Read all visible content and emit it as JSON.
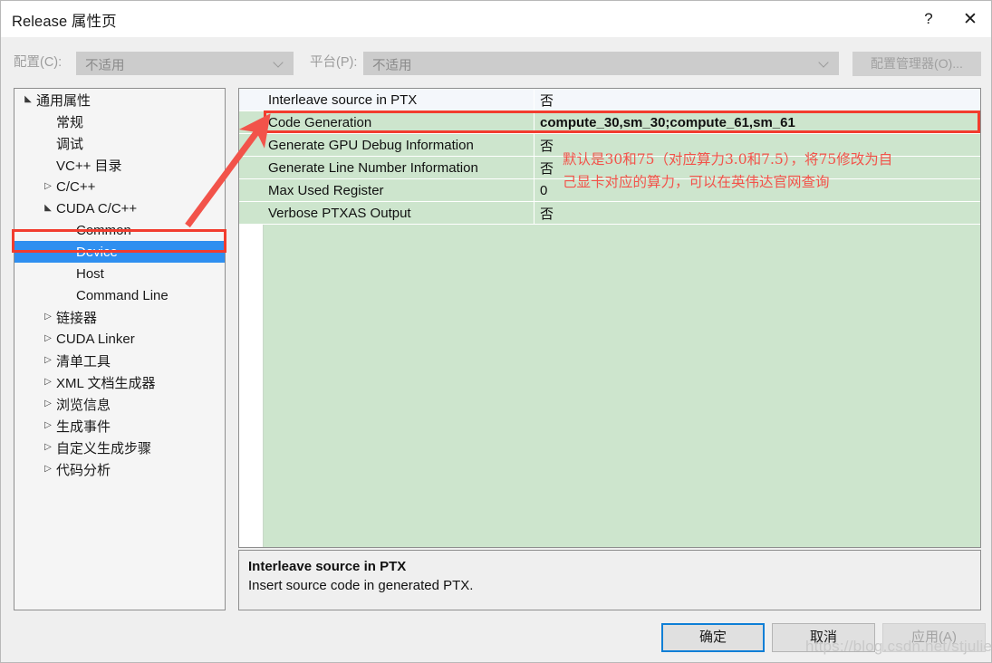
{
  "window": {
    "title": "Release 属性页",
    "help_icon_label": "?",
    "close_icon_label": "✕"
  },
  "config_bar": {
    "configuration_label": "配置(C):",
    "configuration_value": "不适用",
    "platform_label": "平台(P):",
    "platform_value": "不适用",
    "config_manager_button": "配置管理器(O)..."
  },
  "tree": {
    "items": [
      {
        "label": "通用属性",
        "indent": 0,
        "arrow": "▲",
        "selected": false
      },
      {
        "label": "常规",
        "indent": 1,
        "arrow": "",
        "selected": false
      },
      {
        "label": "调试",
        "indent": 1,
        "arrow": "",
        "selected": false
      },
      {
        "label": "VC++ 目录",
        "indent": 1,
        "arrow": "",
        "selected": false
      },
      {
        "label": "C/C++",
        "indent": 1,
        "arrow": "▷",
        "selected": false
      },
      {
        "label": "CUDA C/C++",
        "indent": 1,
        "arrow": "▲",
        "selected": false
      },
      {
        "label": "Common",
        "indent": 2,
        "arrow": "",
        "selected": false
      },
      {
        "label": "Device",
        "indent": 2,
        "arrow": "",
        "selected": true
      },
      {
        "label": "Host",
        "indent": 2,
        "arrow": "",
        "selected": false
      },
      {
        "label": "Command Line",
        "indent": 2,
        "arrow": "",
        "selected": false
      },
      {
        "label": "链接器",
        "indent": 1,
        "arrow": "▷",
        "selected": false
      },
      {
        "label": "CUDA Linker",
        "indent": 1,
        "arrow": "▷",
        "selected": false
      },
      {
        "label": "清单工具",
        "indent": 1,
        "arrow": "▷",
        "selected": false
      },
      {
        "label": "XML 文档生成器",
        "indent": 1,
        "arrow": "▷",
        "selected": false
      },
      {
        "label": "浏览信息",
        "indent": 1,
        "arrow": "▷",
        "selected": false
      },
      {
        "label": "生成事件",
        "indent": 1,
        "arrow": "▷",
        "selected": false
      },
      {
        "label": "自定义生成步骤",
        "indent": 1,
        "arrow": "▷",
        "selected": false
      },
      {
        "label": "代码分析",
        "indent": 1,
        "arrow": "▷",
        "selected": false
      }
    ]
  },
  "property_grid": {
    "rows": [
      {
        "name": "Interleave source in PTX",
        "value": "否",
        "first": true,
        "bold": false
      },
      {
        "name": "Code Generation",
        "value": "compute_30,sm_30;compute_61,sm_61",
        "first": false,
        "bold": true
      },
      {
        "name": "Generate GPU Debug Information",
        "value": "否",
        "first": false,
        "bold": false
      },
      {
        "name": "Generate Line Number Information",
        "value": "否",
        "first": false,
        "bold": false
      },
      {
        "name": "Max Used Register",
        "value": "0",
        "first": false,
        "bold": false
      },
      {
        "name": "Verbose PTXAS Output",
        "value": "否",
        "first": false,
        "bold": false
      }
    ],
    "highlighted_row_name": "Code Generation"
  },
  "annotation": {
    "line1": "默认是30和75（对应算力3.0和7.5），将75修改为自",
    "line2": "己显卡对应的算力，可以在英伟达官网查询",
    "color": "#f2534a"
  },
  "description": {
    "title": "Interleave source in PTX",
    "body": "Insert source code in generated PTX."
  },
  "footer": {
    "ok_label": "确定",
    "cancel_label": "取消",
    "apply_label": "应用(A)"
  },
  "watermark": {
    "text": "https://blog.csdn.net/stjuliet"
  },
  "colors": {
    "selection_blue": "#2f8ff0",
    "highlight_red": "#f23c2e",
    "grid_green": "#cde5cd",
    "ok_border_blue": "#0f7fd6"
  }
}
